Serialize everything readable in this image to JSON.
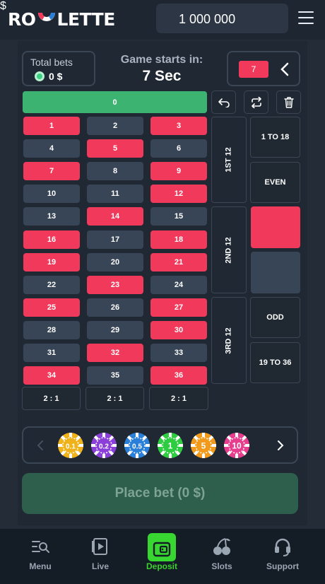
{
  "header": {
    "logo_left": "RO",
    "logo_right": "LETTE",
    "balance": "1 000 000",
    "currency_symbol": "$"
  },
  "status": {
    "total_bets_label": "Total bets",
    "total_bets_value": "0 $",
    "game_starts_label": "Game starts in:",
    "countdown": "7 Sec",
    "last_result": "7"
  },
  "table": {
    "zero": "0",
    "rows": [
      [
        "1",
        "2",
        "3"
      ],
      [
        "4",
        "5",
        "6"
      ],
      [
        "7",
        "8",
        "9"
      ],
      [
        "10",
        "11",
        "12"
      ],
      [
        "13",
        "14",
        "15"
      ],
      [
        "16",
        "17",
        "18"
      ],
      [
        "19",
        "20",
        "21"
      ],
      [
        "22",
        "23",
        "24"
      ],
      [
        "25",
        "26",
        "27"
      ],
      [
        "28",
        "29",
        "30"
      ],
      [
        "31",
        "32",
        "33"
      ],
      [
        "34",
        "35",
        "36"
      ]
    ],
    "red_numbers": [
      1,
      3,
      5,
      7,
      9,
      12,
      14,
      16,
      18,
      19,
      21,
      23,
      25,
      27,
      30,
      32,
      34,
      36
    ],
    "columns": [
      "2 : 1",
      "2 : 1",
      "2 : 1"
    ],
    "dozens": [
      "1ST 12",
      "2ND 12",
      "3RD 12"
    ],
    "outside": [
      "1 TO 18",
      "EVEN",
      "",
      "",
      "ODD",
      "19 TO 36"
    ]
  },
  "chips": [
    "0.1",
    "0.2",
    "0.5",
    "1",
    "5",
    "10"
  ],
  "chip_colors": [
    "#f0b21b",
    "#8b3fd8",
    "#2a7fd8",
    "#2ecc40",
    "#f29a1b",
    "#e83c8f"
  ],
  "place_bet_label": "Place bet (0 $)",
  "nav": [
    {
      "label": "Menu",
      "icon": "menu-search-icon"
    },
    {
      "label": "Live",
      "icon": "live-play-icon"
    },
    {
      "label": "Deposit",
      "icon": "wallet-icon"
    },
    {
      "label": "Slots",
      "icon": "cherries-icon"
    },
    {
      "label": "Support",
      "icon": "headset-icon"
    }
  ],
  "colors": {
    "red": "#f1395b",
    "black": "#384556",
    "green": "#3cb371",
    "accent": "#37d630"
  }
}
